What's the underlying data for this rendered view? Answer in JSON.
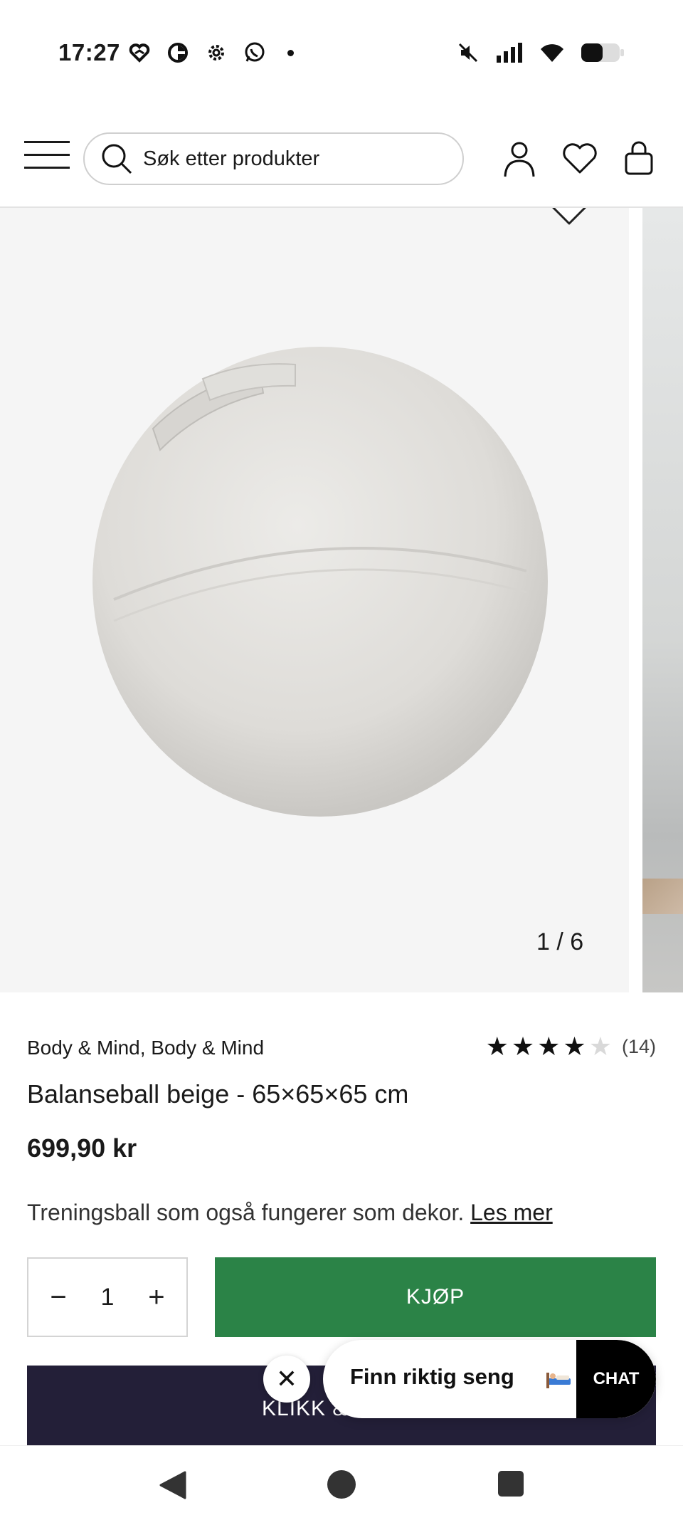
{
  "status_bar": {
    "time": "17:27",
    "left_icons": [
      "heart-app-icon",
      "half-circle-app-icon",
      "settings-icon",
      "whatsapp-icon",
      "dot-icon"
    ],
    "right_icons": [
      "mute-icon",
      "signal-icon",
      "wifi-icon",
      "battery-icon"
    ]
  },
  "header": {
    "search_placeholder": "Søk etter produkter",
    "icons": [
      "menu-icon",
      "search-icon",
      "account-icon",
      "wishlist-icon",
      "cart-icon"
    ]
  },
  "gallery": {
    "counter": "1 / 6",
    "current_index": 1,
    "total": 6
  },
  "product": {
    "brand": "Body & Mind, Body & Mind",
    "rating_count": "(14)",
    "rating_value": 4,
    "rating_max": 5,
    "title": "Balanseball beige - 65×65×65 cm",
    "price": "699,90 kr",
    "description": "Treningsball som også fungerer som dekor.",
    "read_more": "Les mer"
  },
  "purchase": {
    "quantity": "1",
    "minus": "−",
    "plus": "+",
    "buy_label": "KJØP",
    "secondary_label": "KLIKK &",
    "buy_color": "#2b8347",
    "secondary_color": "#231f38"
  },
  "chat": {
    "close": "✕",
    "message": "Finn riktig seng",
    "button": "CHAT"
  }
}
